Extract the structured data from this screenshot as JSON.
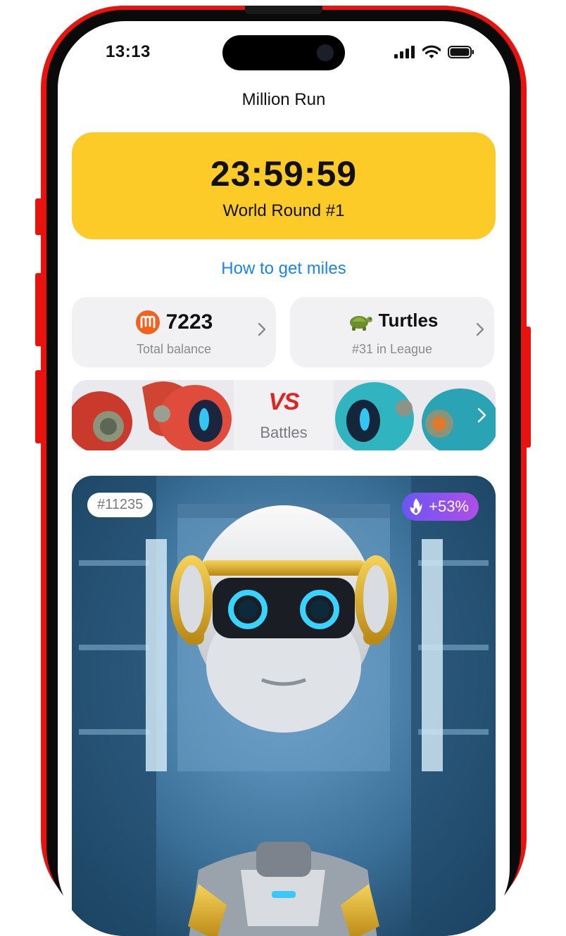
{
  "status_bar": {
    "time": "13:13"
  },
  "app": {
    "title": "Million Run"
  },
  "timer": {
    "countdown": "23:59:59",
    "round": "World Round #1"
  },
  "help_link": {
    "label": "How to get miles"
  },
  "balance": {
    "coin_icon": "miles-coin-icon",
    "value": "7223",
    "label": "Total balance"
  },
  "league": {
    "icon": "turtle-icon",
    "name": "Turtles",
    "rank_label": "#31 in League"
  },
  "battles": {
    "vs_label": "VS",
    "label": "Battles"
  },
  "nft": {
    "id_label": "#11235",
    "boost_label": "+53%",
    "boost_icon": "flame-icon"
  },
  "colors": {
    "frame": "#e6130f",
    "timer_bg": "#fccb28",
    "link": "#1a84f0",
    "vs": "#e02424",
    "coin": "#f2621f"
  }
}
